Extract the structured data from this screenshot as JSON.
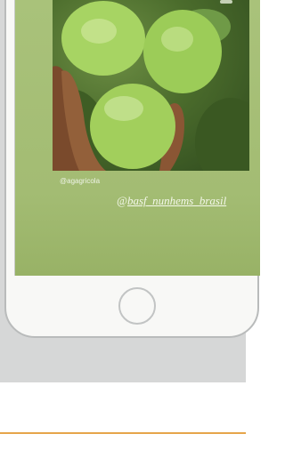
{
  "post": {
    "photo_credit": "@agagricola",
    "mention_at": "@",
    "mention_handle": "basf_nunhems_brasil"
  },
  "icons": {
    "photo": "tomato-photo",
    "home_button": "home-button-circle"
  },
  "colors": {
    "screen_green": "#a9c27a",
    "band_gray": "#d6d7d7",
    "accent_orange": "#e6a54a"
  }
}
